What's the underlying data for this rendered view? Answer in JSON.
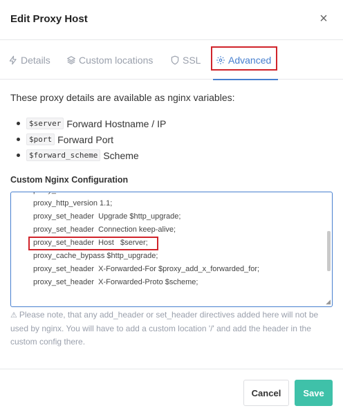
{
  "modal": {
    "title": "Edit Proxy Host",
    "close_label": "×"
  },
  "tabs": [
    {
      "label": "Details",
      "icon": "bolt-icon",
      "active": false
    },
    {
      "label": "Custom locations",
      "icon": "layers-icon",
      "active": false
    },
    {
      "label": "SSL",
      "icon": "shield-icon",
      "active": false
    },
    {
      "label": "Advanced",
      "icon": "gear-icon",
      "active": true
    }
  ],
  "intro": "These proxy details are available as nginx variables:",
  "variables": [
    {
      "code": "$server",
      "desc": "Forward Hostname / IP"
    },
    {
      "code": "$port",
      "desc": "Forward Port"
    },
    {
      "code": "$forward_scheme",
      "desc": "Scheme"
    }
  ],
  "config_label": "Custom Nginx Configuration",
  "config_lines": [
    "proxy_http_version 1.1;",
    "proxy_set_header  Upgrade $http_upgrade;",
    "proxy_set_header  Connection keep-alive;",
    "proxy_set_header  Host   $server;",
    "proxy_cache_bypass $http_upgrade;",
    "proxy_set_header  X-Forwarded-For $proxy_add_x_forwarded_for;",
    "proxy_set_header  X-Forwarded-Proto $scheme;"
  ],
  "note": {
    "icon": "warning-icon",
    "text": "Please note, that any add_header or set_header directives added here will not be used by nginx. You will have to add a custom location '/' and add the header in the custom config there."
  },
  "footer": {
    "cancel_label": "Cancel",
    "save_label": "Save"
  },
  "colors": {
    "accent": "#467fcf",
    "save": "#3fc1a9",
    "highlight": "#d0232a"
  }
}
